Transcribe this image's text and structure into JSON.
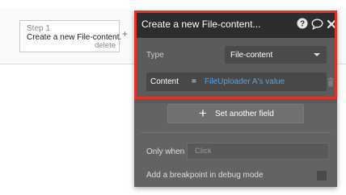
{
  "workflow": {
    "step_number": "Step 1",
    "step_title": "Create a new File-content...",
    "delete_label": "delete",
    "add_symbol": "+"
  },
  "editor": {
    "title": "Create a new File-content...",
    "icons": [
      "help-icon",
      "comment-icon",
      "close-icon"
    ],
    "type_label": "Type",
    "type_value": "File-content",
    "content_label": "Content",
    "content_eq": "=",
    "content_value": "FileUploader A's value",
    "set_field_symbol": "+",
    "set_field_label": "Set another field",
    "only_when_label": "Only when",
    "only_when_placeholder": "Click",
    "breakpoint_label": "Add a breakpoint in debug mode"
  },
  "colors": {
    "highlight": "#e0322b",
    "dynamic_value": "#4ea6e6",
    "header": "#2d2d2d",
    "panel": "#636363"
  }
}
